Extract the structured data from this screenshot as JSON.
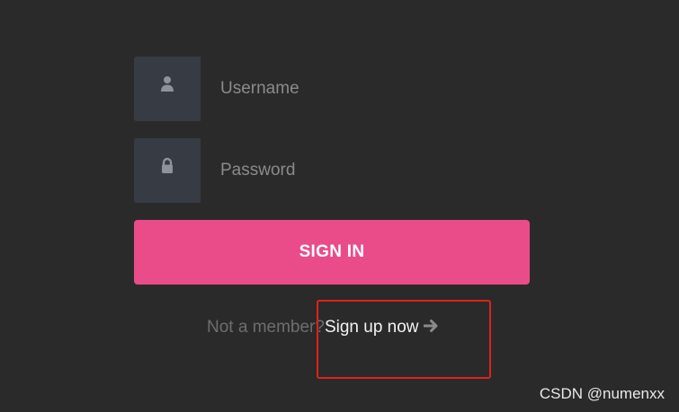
{
  "login_form": {
    "username": {
      "placeholder": "Username",
      "value": "",
      "icon": "user-icon"
    },
    "password": {
      "placeholder": "Password",
      "value": "",
      "icon": "lock-icon"
    },
    "signin_label": "SIGN IN",
    "signup_prompt": "Not a member?",
    "signup_link_label": "Sign up now",
    "signup_arrow_icon": "arrow-right-icon"
  },
  "watermark": "CSDN @numenxx",
  "colors": {
    "background": "#2a2a2a",
    "icon_box": "#363b44",
    "accent_pink": "#ea4c89",
    "highlight_red": "#e0211d"
  }
}
